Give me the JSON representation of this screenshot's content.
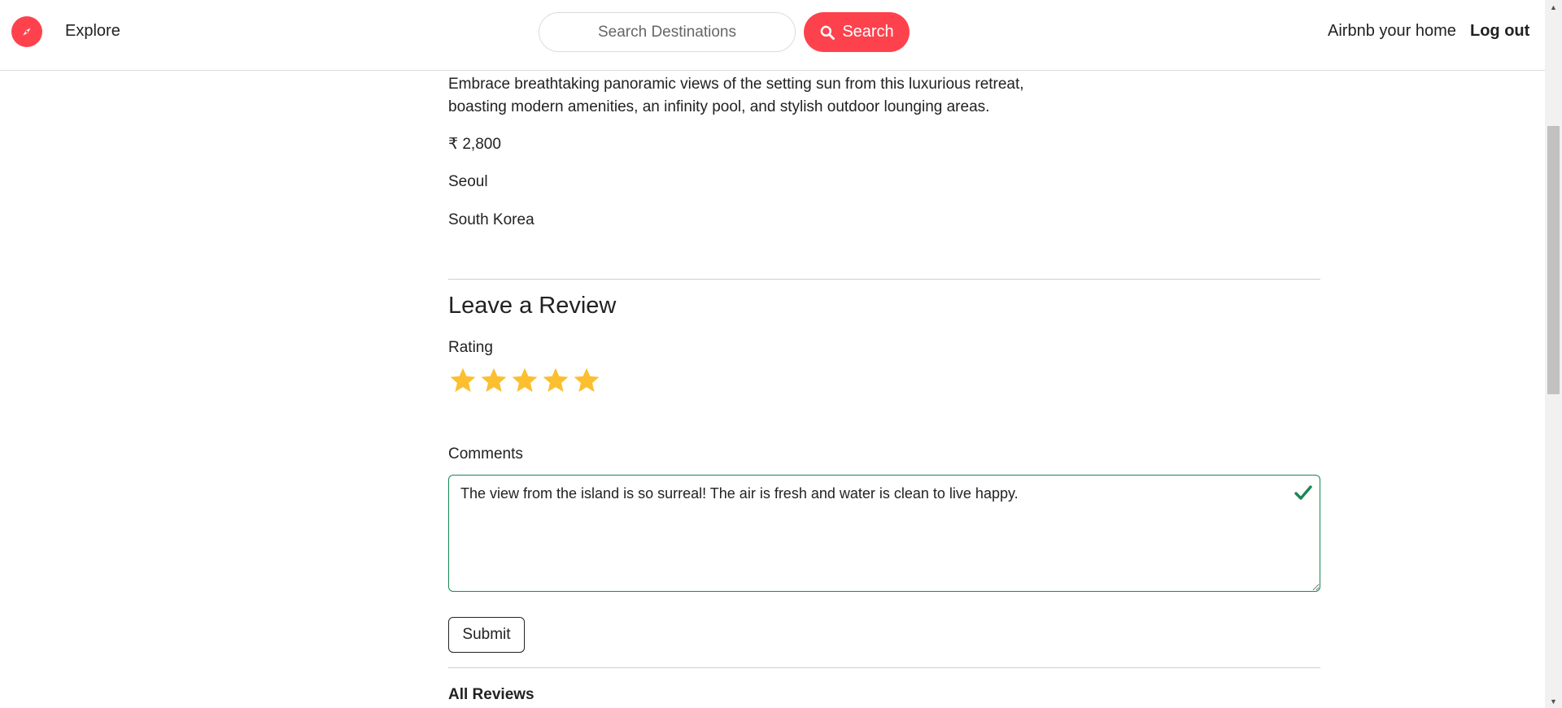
{
  "navbar": {
    "explore_label": "Explore",
    "search_placeholder": "Search Destinations",
    "search_button_label": "Search",
    "host_label": "Airbnb your home",
    "logout_label": "Log out"
  },
  "listing": {
    "description": "Embrace breathtaking panoramic views of the setting sun from this luxurious retreat, boasting modern amenities, an infinity pool, and stylish outdoor lounging areas.",
    "price": "₹ 2,800",
    "location": "Seoul",
    "country": "South Korea"
  },
  "review_form": {
    "heading": "Leave a Review",
    "rating_label": "Rating",
    "rating_value": 5,
    "rating_max": 5,
    "comments_label": "Comments",
    "comments_value": "The view from the island is so surreal! The air is fresh and water is clean to live happy.",
    "submit_label": "Submit"
  },
  "reviews": {
    "heading": "All Reviews"
  },
  "colors": {
    "brand": "#fe424d",
    "star": "#fbbf2f",
    "valid": "#198754"
  },
  "icons": [
    "compass-icon",
    "search-icon",
    "star-icon",
    "check-icon"
  ]
}
